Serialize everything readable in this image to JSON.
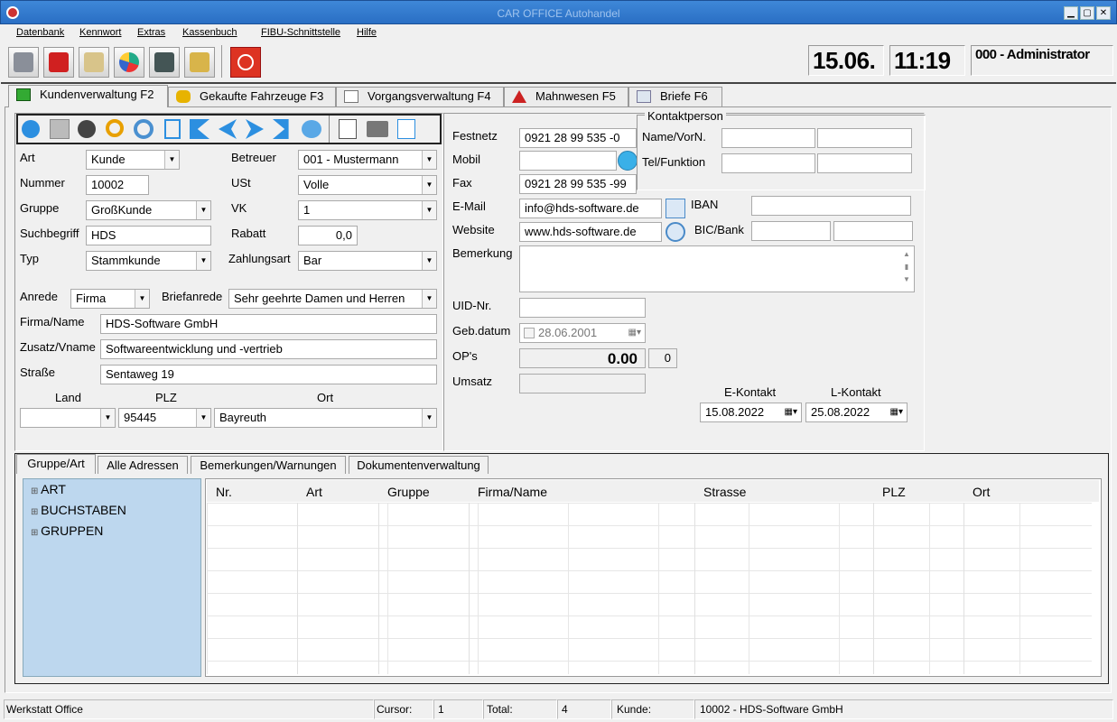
{
  "window": {
    "title": "CAR OFFICE Autohandel",
    "minimize": "▁",
    "maximize": "▢",
    "close": "✕"
  },
  "menu": [
    "Datenbank",
    "Kennwort",
    "Extras",
    "Kassenbuch",
    "FIBU-Schnittstelle",
    "Hilfe"
  ],
  "header": {
    "date": "15.06.",
    "time": "11:19",
    "user": "000 - Administrator"
  },
  "toolbar_icons": [
    "customers-icon",
    "car-icon",
    "documents-icon",
    "pie-chart-icon",
    "person-icon",
    "building-icon",
    "power-icon"
  ],
  "tabs": [
    "Kundenverwaltung F2",
    "Gekaufte Fahrzeuge F3",
    "Vorgangsverwaltung F4",
    "Mahnwesen F5",
    "Briefe F6"
  ],
  "form": {
    "art_label": "Art",
    "art": "Kunde",
    "nummer_label": "Nummer",
    "nummer": "10002",
    "gruppe_label": "Gruppe",
    "gruppe": "GroßKunde",
    "suchbegriff_label": "Suchbegriff",
    "suchbegriff": "HDS",
    "typ_label": "Typ",
    "typ": "Stammkunde",
    "betreuer_label": "Betreuer",
    "betreuer": "001 - Mustermann",
    "ust_label": "USt",
    "ust": "Volle",
    "vk_label": "VK",
    "vk": "1",
    "rabatt_label": "Rabatt",
    "rabatt": "0,0",
    "zahlungsart_label": "Zahlungsart",
    "zahlungsart": "Bar",
    "anrede_label": "Anrede",
    "anrede": "Firma",
    "briefanrede_label": "Briefanrede",
    "briefanrede": "Sehr geehrte Damen und Herren",
    "firma_label": "Firma/Name",
    "firma": "HDS-Software GmbH",
    "zusatz_label": "Zusatz/Vname",
    "zusatz": "Softwareentwicklung und -vertrieb",
    "strasse_label": "Straße",
    "strasse": "Sentaweg 19",
    "land_label": "Land",
    "land": "",
    "plz_label": "PLZ",
    "plz": "95445",
    "ort_label": "Ort",
    "ort": "Bayreuth"
  },
  "contact": {
    "festnetz_label": "Festnetz",
    "festnetz": "0921 28 99 535 -0",
    "mobil_label": "Mobil",
    "mobil": "",
    "fax_label": "Fax",
    "fax": "0921 28 99 535 -99",
    "email_label": "E-Mail",
    "email": "info@hds-software.de",
    "website_label": "Website",
    "website": "www.hds-software.de",
    "bemerkung_label": "Bemerkung",
    "uid_label": "UID-Nr.",
    "gebdatum_label": "Geb.datum",
    "gebdatum": "28.06.2001",
    "ops_label": "OP's",
    "ops_amount": "0.00",
    "ops_count": "0",
    "umsatz_label": "Umsatz",
    "kontaktperson_title": "Kontaktperson",
    "name_label": "Name/VorN.",
    "telfunktion_label": "Tel/Funktion",
    "iban_label": "IBAN",
    "bic_label": "BIC/Bank",
    "ekontakt_label": "E-Kontakt",
    "ekontakt": "15.08.2022",
    "lkontakt_label": "L-Kontakt",
    "lkontakt": "25.08.2022"
  },
  "lower_tabs": [
    "Gruppe/Art",
    "Alle Adressen",
    "Bemerkungen/Warnungen",
    "Dokumentenverwaltung"
  ],
  "tree": [
    "ART",
    "BUCHSTABEN",
    "GRUPPEN"
  ],
  "grid_columns": [
    "Nr.",
    "Art",
    "Gruppe",
    "Firma/Name",
    "Strasse",
    "PLZ",
    "Ort"
  ],
  "status": {
    "app": "Werkstatt Office",
    "cursor_label": "Cursor:",
    "cursor": "1",
    "total_label": "Total:",
    "total": "4",
    "kunde_label": "Kunde:",
    "kunde": "10002 - HDS-Software GmbH"
  }
}
